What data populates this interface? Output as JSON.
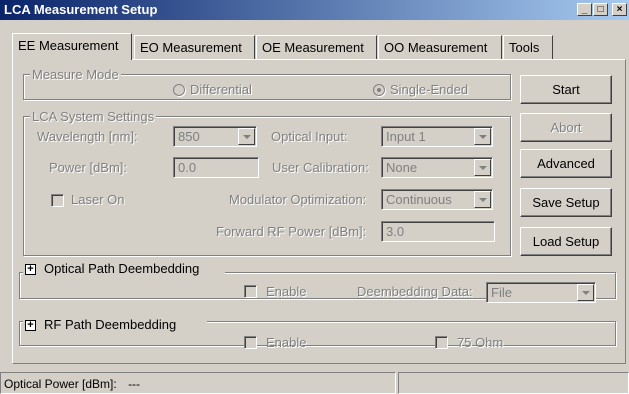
{
  "window": {
    "title": "LCA Measurement Setup"
  },
  "tabs": [
    {
      "label": "EE Measurement",
      "active": true
    },
    {
      "label": "EO Measurement",
      "active": false
    },
    {
      "label": "OE Measurement",
      "active": false
    },
    {
      "label": "OO Measurement",
      "active": false
    },
    {
      "label": "Tools",
      "active": false
    }
  ],
  "measure_mode": {
    "title": "Measure Mode",
    "differential_label": "Differential",
    "single_ended_label": "Single-Ended",
    "selected": "Single-Ended"
  },
  "lca_settings": {
    "title": "LCA System Settings",
    "wavelength_label": "Wavelength [nm]:",
    "wavelength_value": "850",
    "optical_input_label": "Optical Input:",
    "optical_input_value": "Input 1",
    "power_label": "Power [dBm]:",
    "power_value": "0.0",
    "user_calibration_label": "User Calibration:",
    "user_calibration_value": "None",
    "laser_on_label": "Laser On",
    "laser_on_checked": false,
    "modulator_opt_label": "Modulator Optimization:",
    "modulator_opt_value": "Continuous",
    "forward_rf_label": "Forward RF Power [dBm]:",
    "forward_rf_value": "3.0"
  },
  "buttons": {
    "start": "Start",
    "abort": "Abort",
    "advanced": "Advanced",
    "save_setup": "Save Setup",
    "load_setup": "Load Setup"
  },
  "optical_path": {
    "title": "Optical Path Deembedding",
    "expander": "+",
    "enable_label": "Enable",
    "enable_checked": false,
    "data_label": "Deembedding Data:",
    "data_value": "File"
  },
  "rf_path": {
    "title": "RF Path Deembedding",
    "expander": "+",
    "enable_label": "Enable",
    "enable_checked": false,
    "ohm_label": "75 Ohm",
    "ohm_checked": false
  },
  "statusbar": {
    "optical_power_label": "Optical Power [dBm]:",
    "optical_power_value": "---"
  }
}
